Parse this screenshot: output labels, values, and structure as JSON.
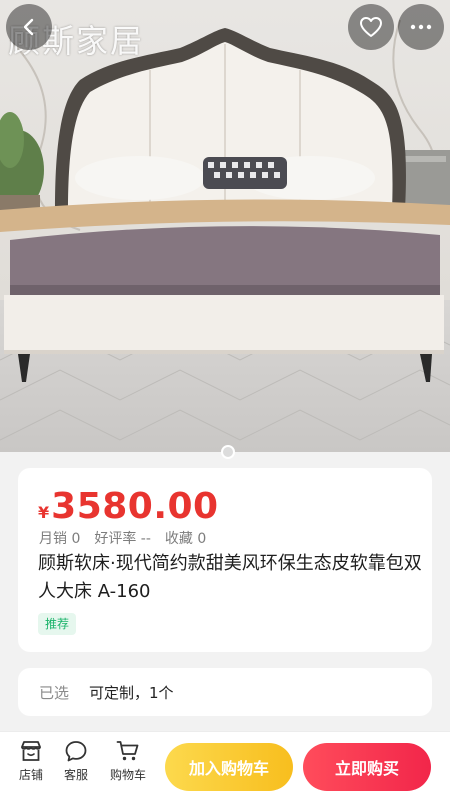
{
  "hero": {
    "brand_watermark": "顾斯家居"
  },
  "icons": {
    "back": "chevron-left-icon",
    "favorite": "heart-icon",
    "more": "ellipsis-icon",
    "shop": "shop-icon",
    "service": "chat-bubble-icon",
    "cart": "cart-icon"
  },
  "product": {
    "currency": "¥",
    "price": "3580.00",
    "stats": {
      "monthly_sales": "月销 0",
      "rating": "好评率 --",
      "favorites": "收藏 0"
    },
    "title": "顾斯软床·现代简约款甜美风环保生态皮软靠包双人大床 A-160",
    "tag": "推荐"
  },
  "selection": {
    "label": "已选",
    "value": "可定制，1个"
  },
  "bottom_bar": {
    "shop": "店铺",
    "service": "客服",
    "cart": "购物车",
    "add_to_cart": "加入购物车",
    "buy_now": "立即购买"
  },
  "colors": {
    "price": "#e8342f",
    "tag_text": "#1bb36a",
    "add_to_cart": "#fcd94d",
    "buy_now": "#f2264a"
  }
}
